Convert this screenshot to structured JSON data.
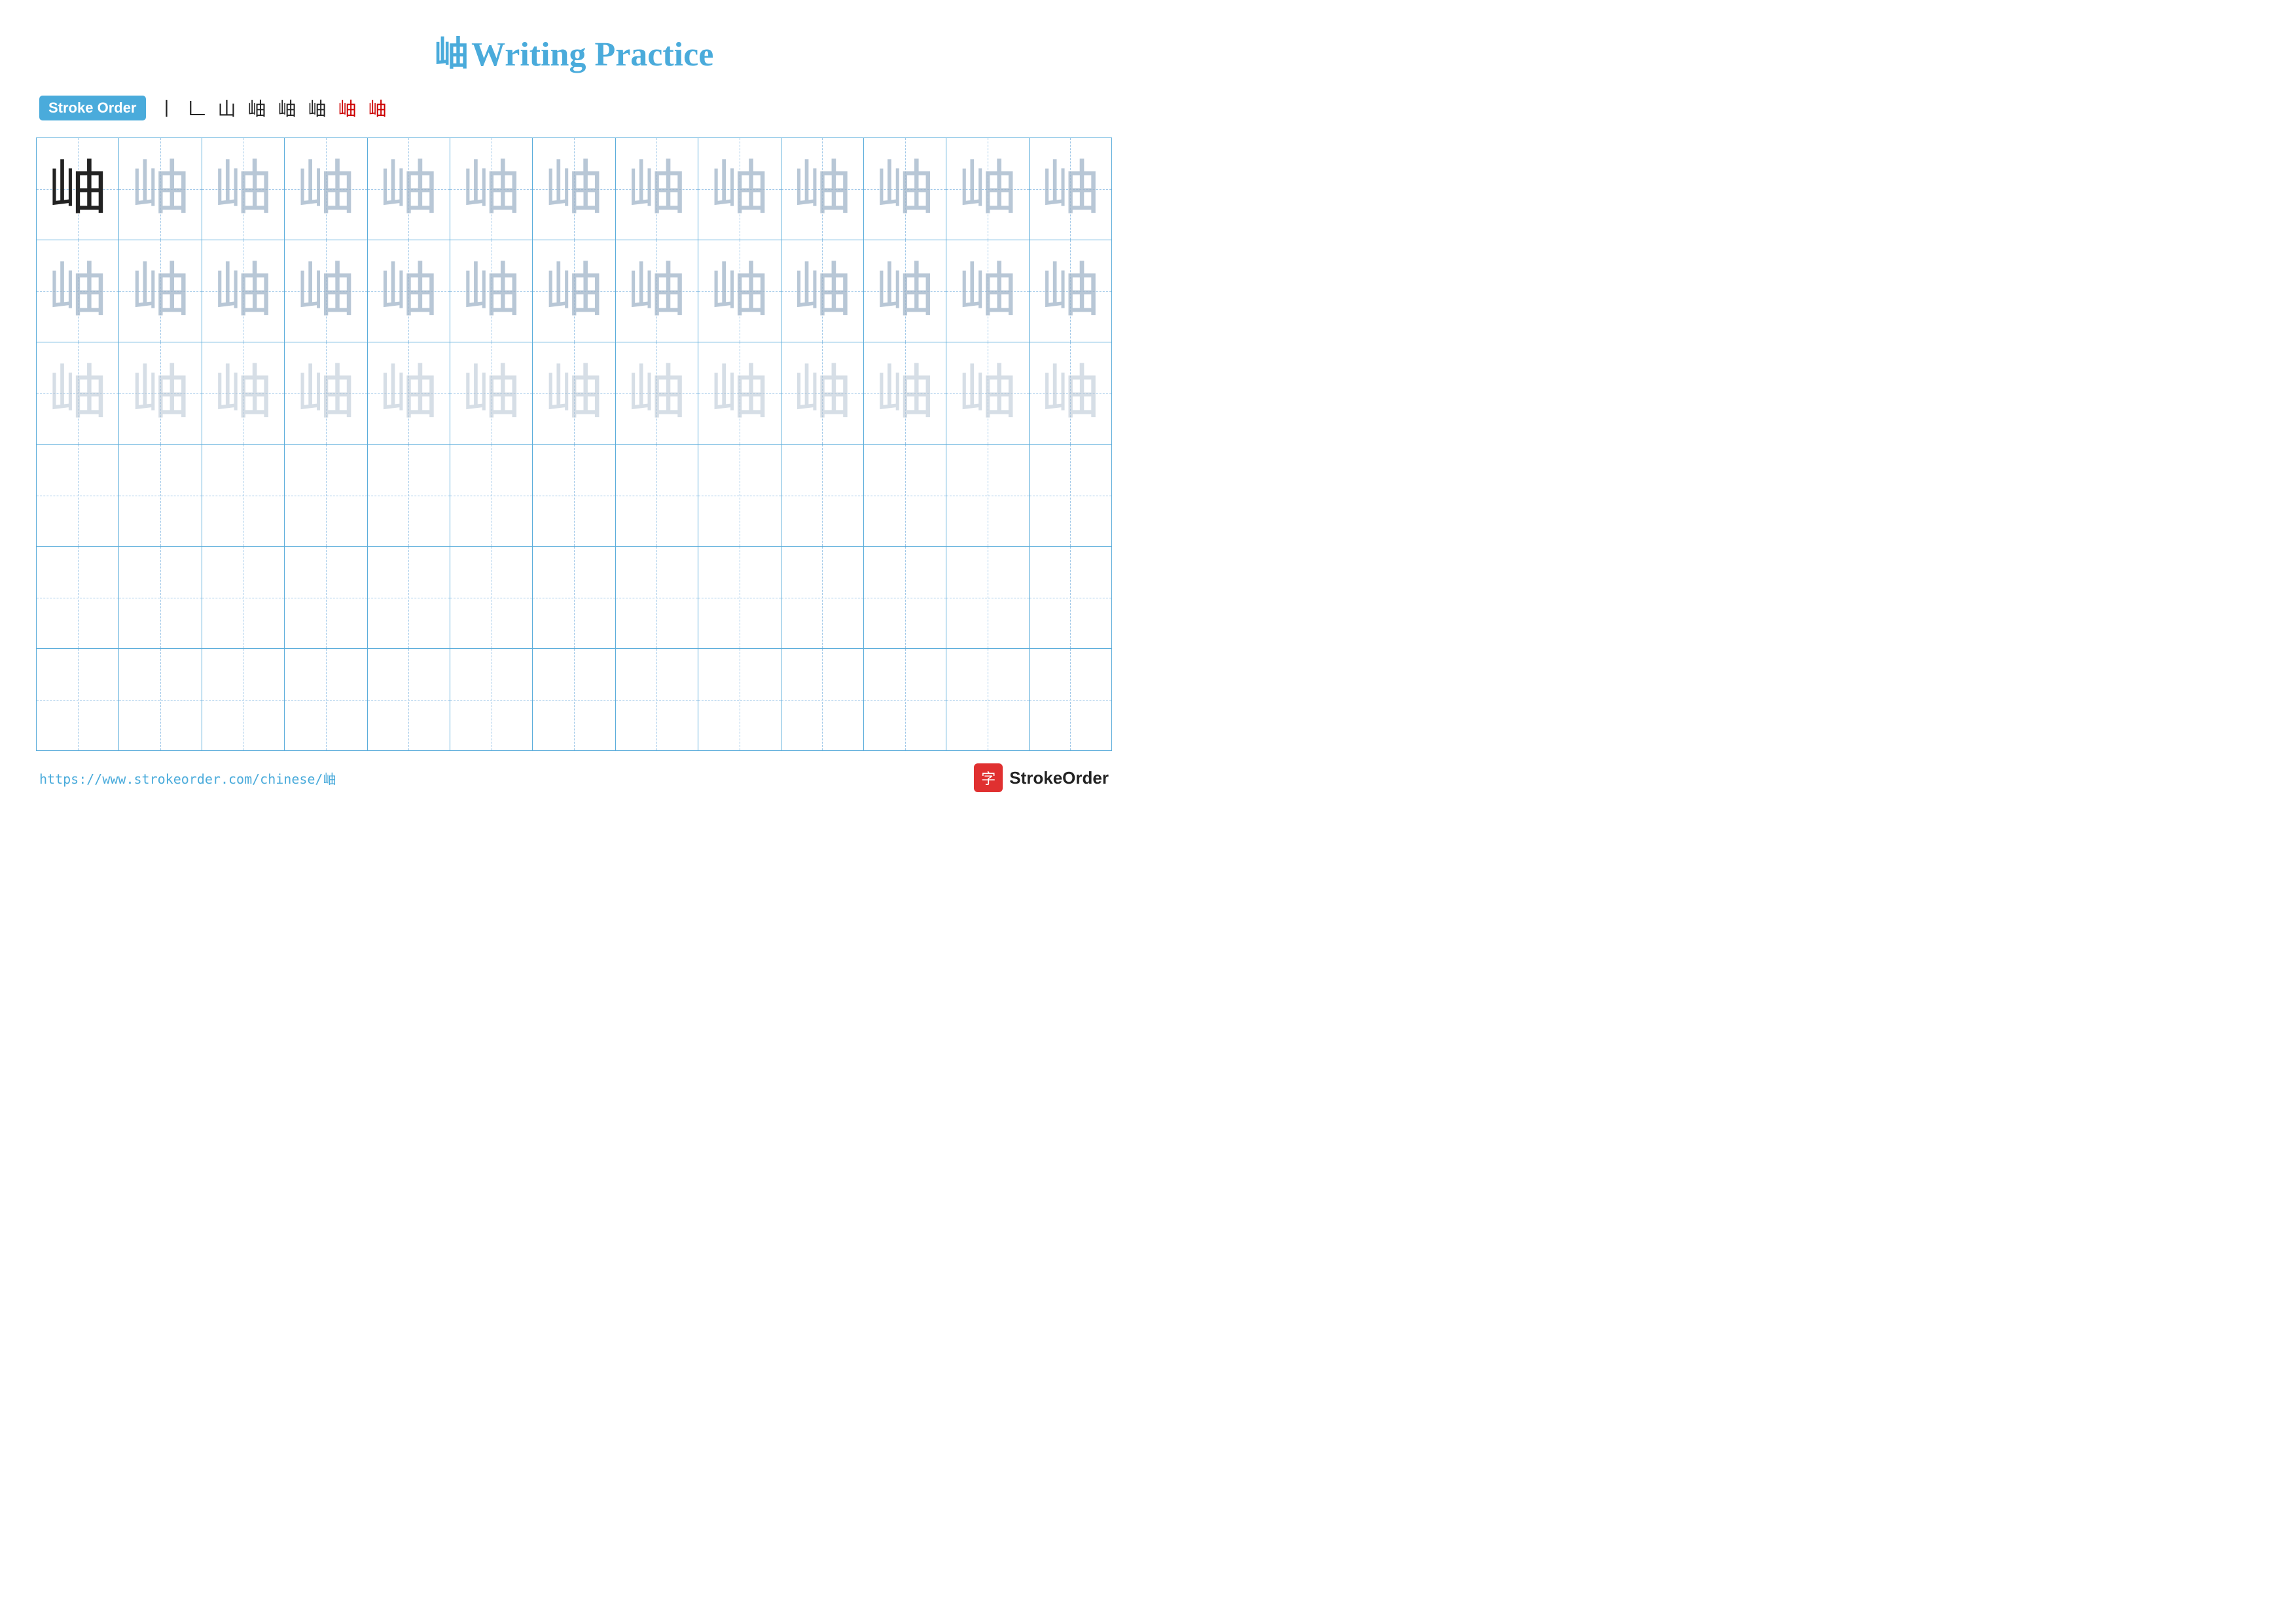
{
  "title": {
    "char": "岫",
    "label": "Writing Practice"
  },
  "stroke_order": {
    "badge": "Stroke Order",
    "steps": [
      "丨",
      "𠃊",
      "山",
      "山丨",
      "岫⻌",
      "岫冂",
      "岫申",
      "岫"
    ]
  },
  "grid": {
    "rows": 6,
    "cols": 13,
    "char": "岫",
    "row_styles": [
      "solid+light1",
      "light1",
      "light2",
      "empty",
      "empty",
      "empty"
    ]
  },
  "footer": {
    "url": "https://www.strokeorder.com/chinese/岫",
    "logo_char": "字",
    "logo_text": "StrokeOrder"
  }
}
